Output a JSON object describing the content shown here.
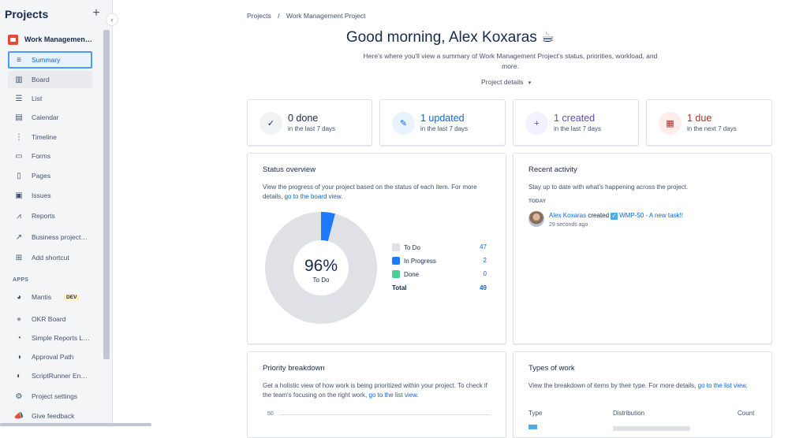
{
  "sidebar": {
    "title": "Projects",
    "project_name": "Work Managemen…",
    "items": [
      {
        "label": "Summary",
        "icon": "summary-icon"
      },
      {
        "label": "Board",
        "icon": "board-icon"
      },
      {
        "label": "List",
        "icon": "list-icon"
      },
      {
        "label": "Calendar",
        "icon": "calendar-icon"
      },
      {
        "label": "Timeline",
        "icon": "timeline-icon"
      },
      {
        "label": "Forms",
        "icon": "forms-icon"
      },
      {
        "label": "Pages",
        "icon": "pages-icon"
      },
      {
        "label": "Issues",
        "icon": "issues-icon"
      },
      {
        "label": "Reports",
        "icon": "reports-icon"
      },
      {
        "label": "Business project…",
        "icon": "business-project-icon"
      },
      {
        "label": "Add shortcut",
        "icon": "add-shortcut-icon"
      }
    ],
    "apps_label": "APPS",
    "apps": [
      {
        "label": "Mantis",
        "badge": "DEV",
        "icon": "mantis-icon"
      },
      {
        "label": "OKR Board",
        "icon": "okr-board-icon"
      },
      {
        "label": "Simple Reports L…",
        "icon": "simple-reports-icon"
      },
      {
        "label": "Approval Path",
        "icon": "approval-path-icon"
      },
      {
        "label": "ScriptRunner En…",
        "icon": "scriptrunner-icon"
      },
      {
        "label": "Project settings",
        "icon": "settings-icon"
      },
      {
        "label": "Give feedback",
        "icon": "feedback-icon"
      }
    ]
  },
  "breadcrumb": {
    "root": "Projects",
    "sep": "/",
    "current": "Work Management Project"
  },
  "greeting": "Good morning, Alex Koxaras ☕",
  "subtitle": "Here's where you'll view a summary of Work Management Project's status, priorities, workload, and more.",
  "project_details": "Project details",
  "stats": [
    {
      "value": "0 done",
      "period": "in the last 7 days",
      "icon": "check-icon",
      "color": "#172b4d",
      "bg": "#f1f2f4"
    },
    {
      "value": "1 updated",
      "period": "in the last 7 days",
      "icon": "pencil-icon",
      "color": "#0c66e4",
      "bg": "#e9f2ff"
    },
    {
      "value": "1 created",
      "period": "in the last 7 days",
      "icon": "plus-icon",
      "color": "#5e4db2",
      "bg": "#f3f0ff"
    },
    {
      "value": "1 due",
      "period": "in the next 7 days",
      "icon": "calendar-icon",
      "color": "#ae2e24",
      "bg": "#ffeceb"
    }
  ],
  "status_overview": {
    "title": "Status overview",
    "desc": "View the progress of your project based on the status of each item. For more details,",
    "link": "go to the board view.",
    "center_pct": "96%",
    "center_label": "To Do",
    "legend": [
      {
        "label": "To Do",
        "value": "47",
        "color": "#dfe1e6"
      },
      {
        "label": "In Progress",
        "value": "2",
        "color": "#1d7afc"
      },
      {
        "label": "Done",
        "value": "0",
        "color": "#4bce97"
      }
    ],
    "total_label": "Total",
    "total_value": "49"
  },
  "recent_activity": {
    "title": "Recent activity",
    "desc": "Stay up to date with what's happening across the project.",
    "day": "TODAY",
    "user": "Alex Koxaras",
    "action": "created",
    "item": "WMP-50 - A new task!!",
    "time": "29 seconds ago"
  },
  "priority": {
    "title": "Priority breakdown",
    "desc": "Get a holistic view of how work is being prioritized within your project. To check if the team's focusing on the right work,",
    "link": "go to the list view.",
    "axis_tick": "50"
  },
  "types": {
    "title": "Types of work",
    "desc": "View the breakdown of items by their type. For more details,",
    "link": "go to the list view.",
    "col_type": "Type",
    "col_dist": "Distribution",
    "col_count": "Count"
  },
  "chart_data": {
    "type": "pie",
    "categories": [
      "To Do",
      "In Progress",
      "Done"
    ],
    "values": [
      47,
      2,
      0
    ],
    "title": "Status overview"
  }
}
